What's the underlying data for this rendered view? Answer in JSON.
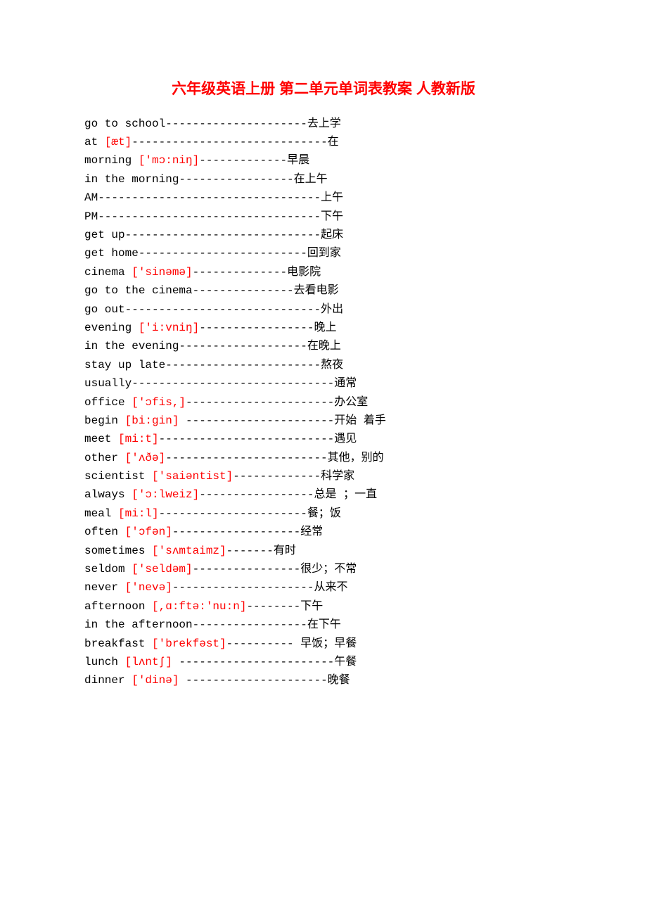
{
  "title": "六年级英语上册 第二单元单词表教案 人教新版",
  "entries": [
    {
      "word": "go to school",
      "ipa": "",
      "dash": "---------------------",
      "cn": "去上学"
    },
    {
      "word": "at ",
      "ipa": "[æt]",
      "dash": "-----------------------------",
      "cn": "在"
    },
    {
      "word": "morning ",
      "ipa": "['mɔ:niŋ]",
      "dash": "-------------",
      "cn": "早晨"
    },
    {
      "word": "in the morning",
      "ipa": "",
      "dash": "-----------------",
      "cn": "在上午"
    },
    {
      "word": "AM",
      "ipa": "",
      "dash": "---------------------------------",
      "cn": "上午"
    },
    {
      "word": "PM",
      "ipa": "",
      "dash": "---------------------------------",
      "cn": "下午"
    },
    {
      "word": "get up",
      "ipa": "",
      "dash": "-----------------------------",
      "cn": "起床"
    },
    {
      "word": "get home",
      "ipa": "",
      "dash": "-------------------------",
      "cn": "回到家"
    },
    {
      "word": "cinema ",
      "ipa": "['sinəmə]",
      "dash": "--------------",
      "cn": "电影院"
    },
    {
      "word": "go to the cinema",
      "ipa": "",
      "dash": "---------------",
      "cn": "去看电影"
    },
    {
      "word": "go out",
      "ipa": "",
      "dash": "-----------------------------",
      "cn": "外出"
    },
    {
      "word": "evening ",
      "ipa": "['i:vniŋ]",
      "dash": "-----------------",
      "cn": "晚上"
    },
    {
      "word": "in the evening",
      "ipa": "",
      "dash": "-------------------",
      "cn": "在晚上"
    },
    {
      "word": "stay up late",
      "ipa": "",
      "dash": "-----------------------",
      "cn": "熬夜"
    },
    {
      "word": "usually",
      "ipa": "",
      "dash": "------------------------------",
      "cn": "通常"
    },
    {
      "word": "office ",
      "ipa": "['ɔfis,]",
      "dash": "----------------------",
      "cn": "办公室"
    },
    {
      "word": "begin ",
      "ipa": "[bi:gin]",
      "dash": " ----------------------",
      "cn": "开始 着手"
    },
    {
      "word": "meet ",
      "ipa": "[mi:t]",
      "dash": "--------------------------",
      "cn": "遇见"
    },
    {
      "word": "other ",
      "ipa": "['ʌðə]",
      "dash": "------------------------",
      "cn": "其他，别的"
    },
    {
      "word": "scientist ",
      "ipa": "['saiəntist]",
      "dash": "-------------",
      "cn": "科学家"
    },
    {
      "word": "always ",
      "ipa": "['ɔ:lweiz]",
      "dash": "-----------------",
      "cn": "总是 ；一直"
    },
    {
      "word": "meal   ",
      "ipa": "[mi:l]",
      "dash": "----------------------",
      "cn": "餐；饭"
    },
    {
      "word": "often   ",
      "ipa": "['ɔfən]",
      "dash": "-------------------",
      "cn": "经常"
    },
    {
      "word": "sometimes ",
      "ipa": "['sʌmtaimz]",
      "dash": "-------",
      "cn": "有时"
    },
    {
      "word": "seldom ",
      "ipa": "['seldəm]",
      "dash": "----------------",
      "cn": "很少；不常"
    },
    {
      "word": "never ",
      "ipa": "['nevə]",
      "dash": "---------------------",
      "cn": "从来不"
    },
    {
      "word": "afternoon ",
      "ipa": "[,ɑ:ftə:'nu:n]",
      "dash": "--------",
      "cn": "下午"
    },
    {
      "word": "in the afternoon",
      "ipa": "",
      "dash": "-----------------",
      "cn": "在下午"
    },
    {
      "word": "breakfast ",
      "ipa": "['brekfəst]",
      "dash": "---------- ",
      "cn": "早饭；早餐"
    },
    {
      "word": "lunch ",
      "ipa": "[lʌntʃ]",
      "dash": " -----------------------",
      "cn": "午餐"
    },
    {
      "word": "dinner ",
      "ipa": "['dinə]",
      "dash": " ---------------------",
      "cn": "晚餐"
    }
  ]
}
